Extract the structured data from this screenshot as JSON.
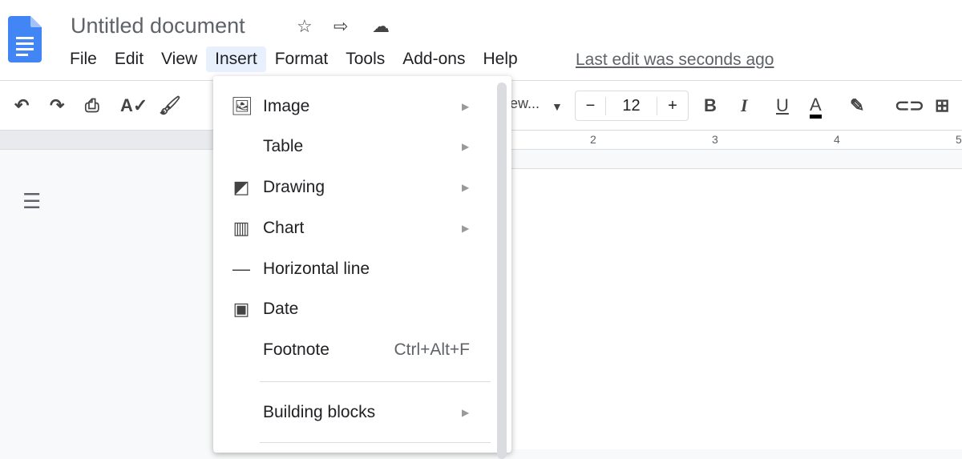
{
  "header": {
    "title": "Untitled document",
    "last_edit": "Last edit was seconds ago",
    "menus": [
      "File",
      "Edit",
      "View",
      "Insert",
      "Format",
      "Tools",
      "Add-ons",
      "Help"
    ],
    "active_menu": "Insert"
  },
  "toolbar": {
    "font_name": "ew...",
    "font_size": "12",
    "minus": "−",
    "plus": "+"
  },
  "ruler": {
    "labels": [
      "2",
      "3",
      "4",
      "5"
    ]
  },
  "insert_menu": {
    "items": [
      {
        "label": "Image",
        "icon": "image-icon",
        "submenu": true
      },
      {
        "label": "Table",
        "icon": "",
        "submenu": true
      },
      {
        "label": "Drawing",
        "icon": "drawing-icon",
        "submenu": true
      },
      {
        "label": "Chart",
        "icon": "chart-icon",
        "submenu": true
      },
      {
        "label": "Horizontal line",
        "icon": "horizontal-line-icon",
        "submenu": false
      },
      {
        "label": "Date",
        "icon": "calendar-icon",
        "submenu": false
      },
      {
        "label": "Footnote",
        "icon": "",
        "shortcut": "Ctrl+Alt+F",
        "highlighted": true
      },
      {
        "label": "Building blocks",
        "icon": "",
        "submenu": true
      }
    ]
  },
  "colors": {
    "highlight_border": "#e8505b",
    "docs_blue": "#4285f4",
    "active_menu_bg": "#e8f0fe"
  }
}
